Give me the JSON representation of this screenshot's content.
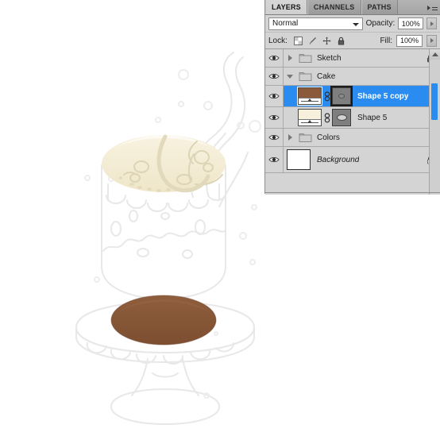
{
  "canvas": {
    "background_color": "#ffffff",
    "artwork_title": "Isometric cake illustration in progress",
    "colors": {
      "sketch_gray": "#ebebeb",
      "sketch_gray_dark": "#dfdfdf",
      "cream": "#f5eed8",
      "cream_shade": "#ece3c6",
      "chocolate": "#8a5a3a",
      "chocolate_dark": "#6f452b",
      "steam": "#e6e6e6"
    }
  },
  "panel": {
    "tabs": [
      {
        "label": "LAYERS",
        "active": true
      },
      {
        "label": "CHANNELS",
        "active": false
      },
      {
        "label": "PATHS",
        "active": false
      }
    ],
    "menu_icon": "panel-menu-icon",
    "blend": {
      "mode": "Normal",
      "opacity_label": "Opacity:",
      "opacity_value": "100%",
      "fill_label": "Fill:",
      "fill_value": "100%"
    },
    "lock": {
      "label": "Lock:",
      "icons": [
        "lock-transparency-icon",
        "lock-image-pixels-icon",
        "lock-position-icon",
        "lock-all-icon"
      ]
    },
    "layers": [
      {
        "type": "group",
        "name": "Sketch",
        "visible": true,
        "expanded": false,
        "locked": true,
        "selected": false
      },
      {
        "type": "group",
        "name": "Cake",
        "visible": true,
        "expanded": true,
        "locked": false,
        "selected": false
      },
      {
        "type": "shape",
        "name": "Shape 5 copy",
        "visible": true,
        "selected": true,
        "thumb_color": "#8a5a3a",
        "linked": true,
        "mask": "vector-mask",
        "mask_focused": true,
        "indent": true
      },
      {
        "type": "shape",
        "name": "Shape 5",
        "visible": true,
        "selected": false,
        "thumb_color": "#f7f0dc",
        "linked": true,
        "mask": "vector-mask",
        "mask_focused": false,
        "indent": true
      },
      {
        "type": "group",
        "name": "Colors",
        "visible": true,
        "expanded": false,
        "locked": false,
        "selected": false
      },
      {
        "type": "background",
        "name": "Background",
        "visible": true,
        "locked": true,
        "selected": false,
        "thumb_color": "#ffffff"
      }
    ],
    "scrollbar": {
      "accent": "#2a8cf0"
    }
  }
}
